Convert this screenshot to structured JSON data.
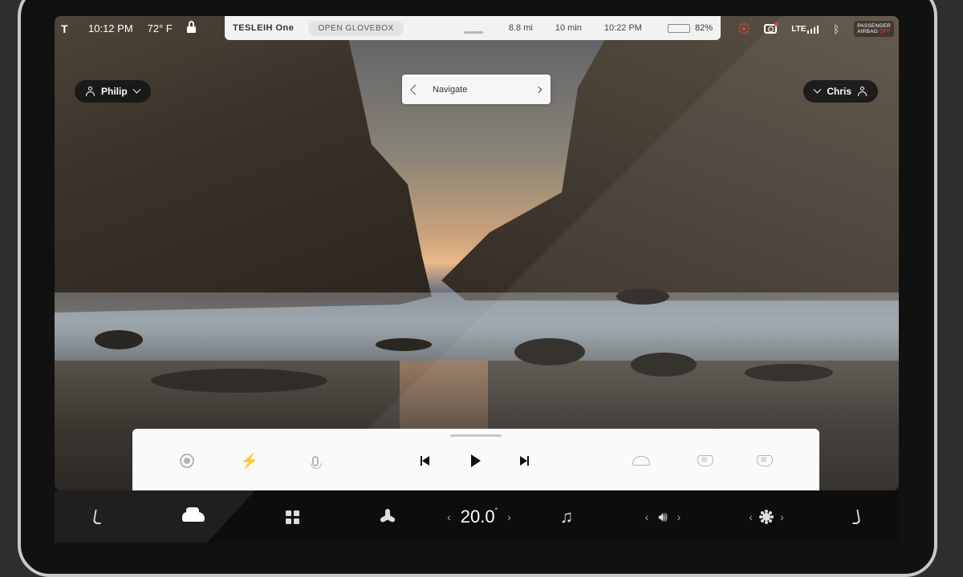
{
  "status_bar": {
    "time": "10:12 PM",
    "temperature": "72° F",
    "car_name": "TESLEIH One",
    "glovebox_button": "OPEN GLOVEBOX",
    "trip_distance": "8.8 mi",
    "trip_duration": "10 min",
    "arrival_time": "10:22 PM",
    "battery_percent": "82%",
    "battery_level": 0.82,
    "network": "LTE",
    "airbag_line1": "PASSENGER",
    "airbag_line2": "AIRBAG",
    "airbag_state": "OFF"
  },
  "profiles": {
    "driver": "Philip",
    "passenger": "Chris"
  },
  "navigate": {
    "label": "Navigate"
  },
  "climate": {
    "temperature": "20.0",
    "unit": "°"
  },
  "colors": {
    "accent_red": "#e2463c",
    "battery_green": "#3cc43c",
    "dock_bg": "#fafafa"
  },
  "icons": {
    "media_source": "disc-icon",
    "charging": "lightning-icon",
    "voice": "microphone-icon",
    "previous": "skip-previous-icon",
    "play": "play-icon",
    "next": "skip-next-icon",
    "wiper": "wiper-icon",
    "rear_defrost": "rear-defrost-icon",
    "front_defrost": "front-defrost-icon"
  }
}
